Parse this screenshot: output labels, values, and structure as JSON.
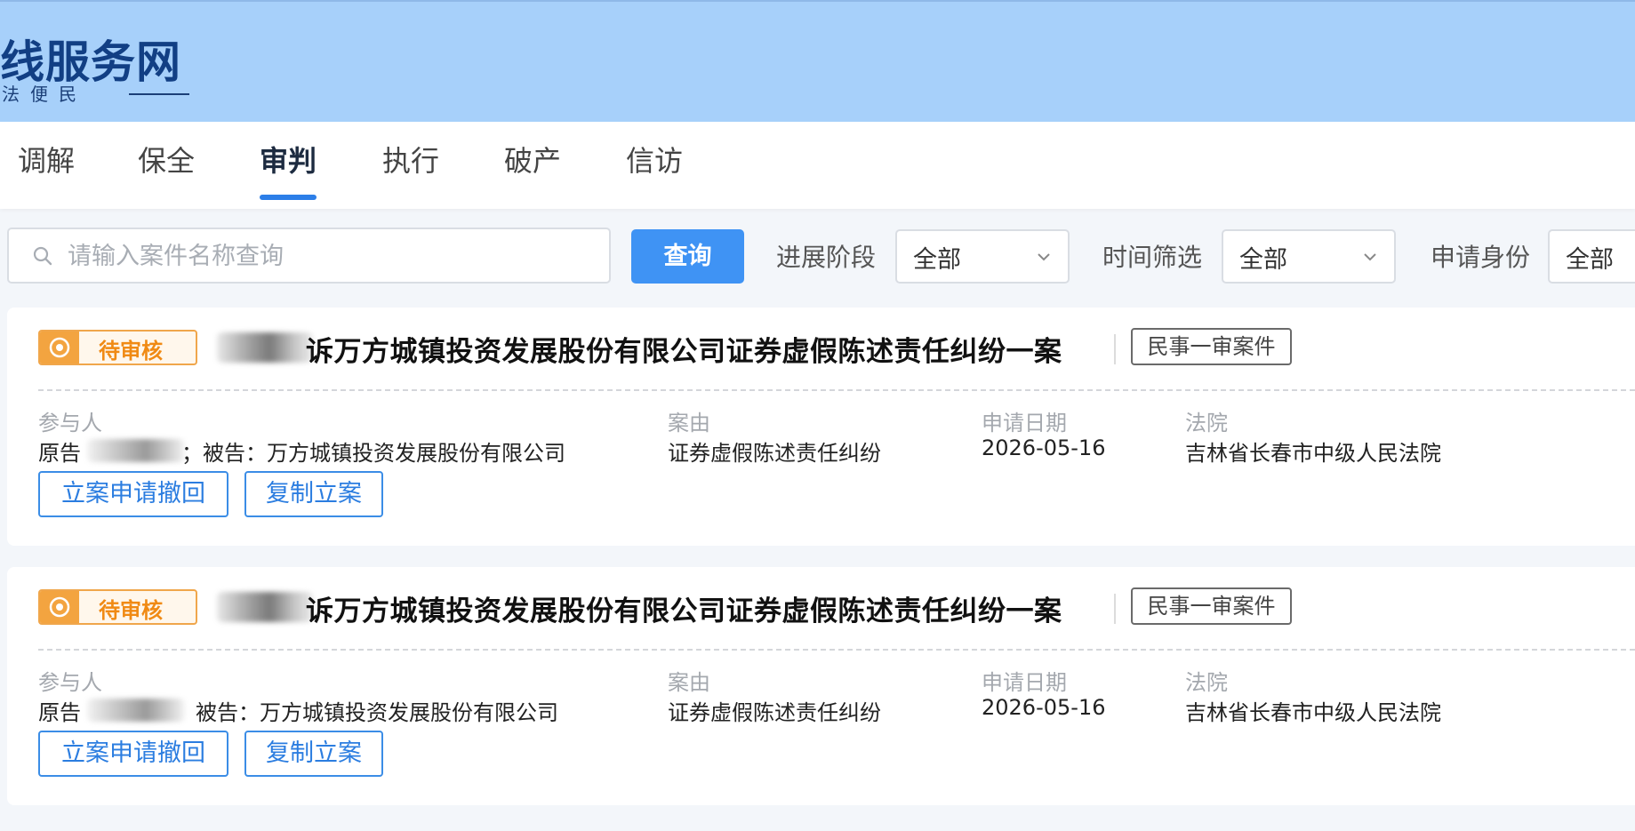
{
  "header": {
    "title": "线服务网",
    "subtitle": "司法便民"
  },
  "tabs": [
    {
      "label": "调解"
    },
    {
      "label": "保全"
    },
    {
      "label": "审判"
    },
    {
      "label": "执行"
    },
    {
      "label": "破产"
    },
    {
      "label": "信访"
    }
  ],
  "active_tab": "审判",
  "filters": {
    "search_placeholder": "请输入案件名称查询",
    "query_label": "查询",
    "stage_label": "进展阶段",
    "stage_value": "全部",
    "time_label": "时间筛选",
    "time_value": "全部",
    "identity_label": "申请身份",
    "identity_value": "全部"
  },
  "field_labels": {
    "participants": "参与人",
    "cause": "案由",
    "date": "申请日期",
    "court": "法院"
  },
  "cases": [
    {
      "status": "待审核",
      "title": "诉万方城镇投资发展股份有限公司证券虚假陈述责任纠纷一案",
      "case_type": "民事一审案件",
      "plaintiff_label": "原告",
      "defendant_text": "；被告：万方城镇投资发展股份有限公司",
      "cause": "证券虚假陈述责任纠纷",
      "date": "2026-05-16",
      "court": "吉林省长春市中级人民法院",
      "withdraw_label": "立案申请撤回",
      "copy_label": "复制立案"
    },
    {
      "status": "待审核",
      "title": "诉万方城镇投资发展股份有限公司证券虚假陈述责任纠纷一案",
      "case_type": "民事一审案件",
      "plaintiff_label": "原告",
      "defendant_text": "被告：万方城镇投资发展股份有限公司",
      "cause": "证券虚假陈述责任纠纷",
      "date": "2026-05-16",
      "court": "吉林省长春市中级人民法院",
      "withdraw_label": "立案申请撤回",
      "copy_label": "复制立案"
    }
  ],
  "colors": {
    "header_bg": "#a7d0fa",
    "accent_blue": "#3f93f4",
    "status_orange": "#f08a14"
  }
}
